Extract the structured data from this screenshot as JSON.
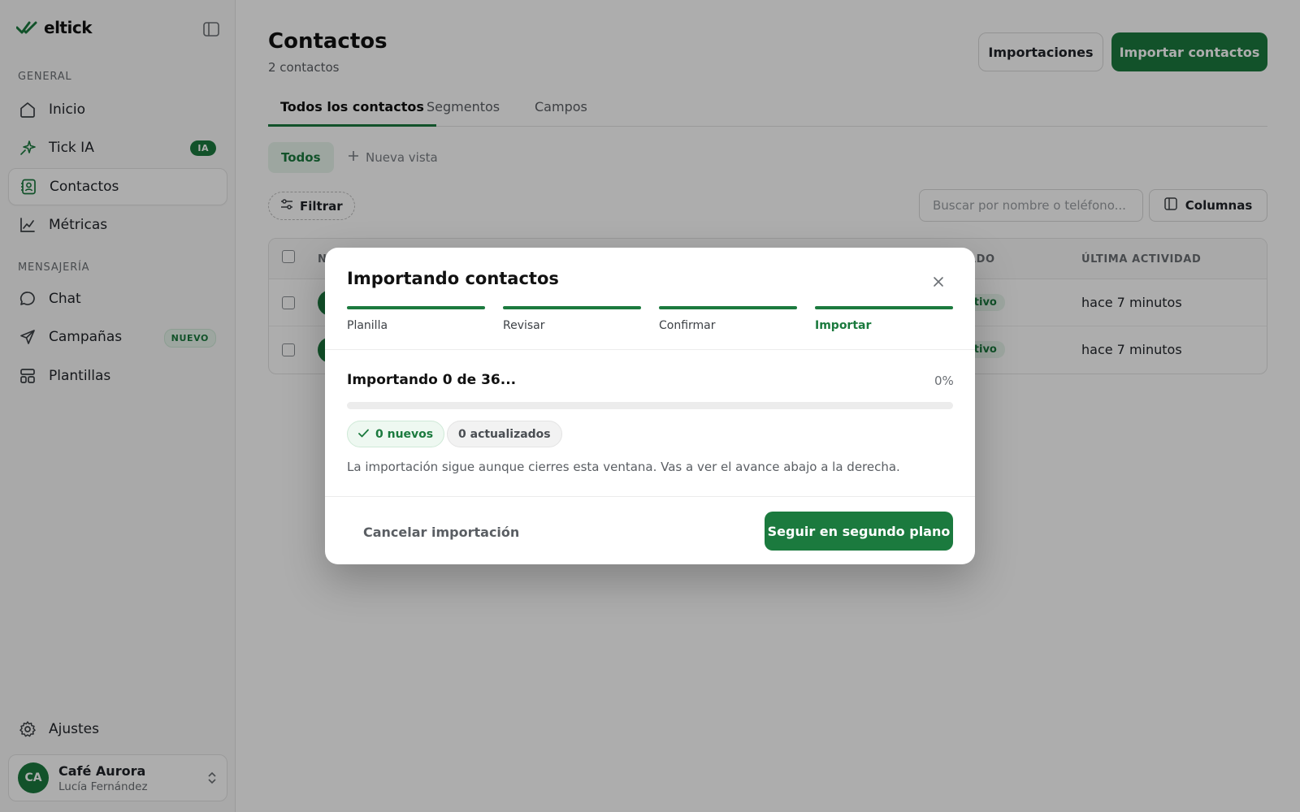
{
  "brand": {
    "name": "eltick"
  },
  "sidebar": {
    "section_general": "GENERAL",
    "section_messaging": "MENSAJERÍA",
    "items": [
      {
        "label": "Inicio",
        "icon": "home-icon"
      },
      {
        "label": "Tick IA",
        "icon": "sparkle-icon",
        "badge": "IA"
      },
      {
        "label": "Contactos",
        "icon": "contacts-icon",
        "active": true
      },
      {
        "label": "Métricas",
        "icon": "chart-icon"
      },
      {
        "label": "Chat",
        "icon": "chat-icon"
      },
      {
        "label": "Campañas",
        "icon": "send-icon",
        "badge": "NUEVO"
      },
      {
        "label": "Plantillas",
        "icon": "templates-icon"
      }
    ],
    "settings_label": "Ajustes",
    "account": {
      "initials": "CA",
      "name": "Café Aurora",
      "user": "Lucía Fernández"
    }
  },
  "header": {
    "title": "Contactos",
    "subtitle": "2 contactos",
    "imports_button": "Importaciones",
    "import_button": "Importar contactos"
  },
  "tabs": [
    "Todos los contactos",
    "Segmentos",
    "Campos"
  ],
  "views": {
    "active": "Todos",
    "new_view": "Nueva vista"
  },
  "toolbar": {
    "filter_label": "Filtrar",
    "search_placeholder": "Buscar por nombre o teléfono...",
    "columns_label": "Columnas"
  },
  "table": {
    "columns": [
      "N",
      "ESTADO",
      "ÚLTIMA ACTIVIDAD"
    ],
    "rows": [
      {
        "status": "Activo",
        "activity": "hace 7 minutos"
      },
      {
        "status": "Activo",
        "activity": "hace 7 minutos"
      }
    ]
  },
  "modal": {
    "title": "Importando contactos",
    "steps": [
      "Planilla",
      "Revisar",
      "Confirmar",
      "Importar"
    ],
    "progress_title": "Importando 0 de 36...",
    "progress_percent_label": "0%",
    "progress_value": 0,
    "new_label": "0 nuevos",
    "updated_label": "0 actualizados",
    "note": "La importación sigue aunque cierres esta ventana. Vas a ver el avance abajo a la derecha.",
    "cancel_label": "Cancelar importación",
    "background_label": "Seguir en segundo plano"
  },
  "colors": {
    "accent": "#1b7a3e",
    "accent_light": "#e8f5ec"
  }
}
